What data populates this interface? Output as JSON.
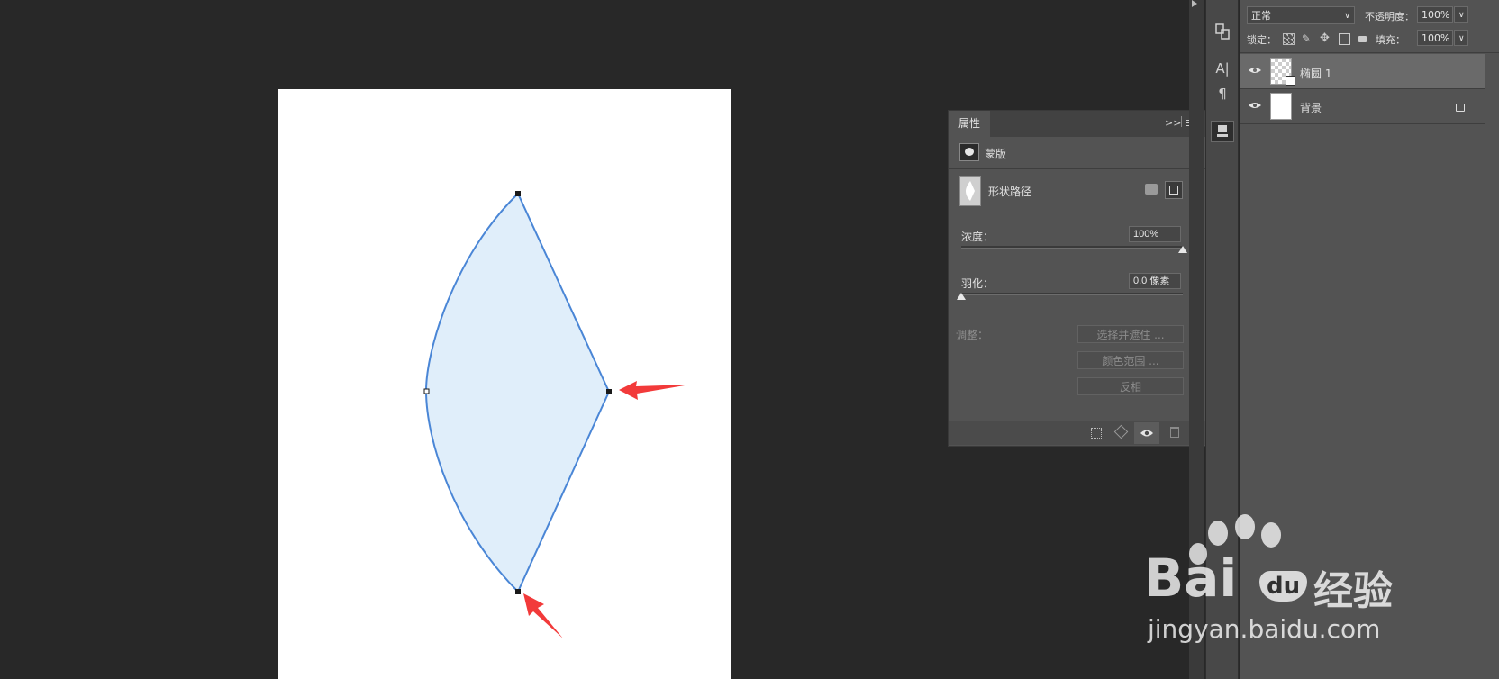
{
  "properties_panel": {
    "tab_label": "属性",
    "section_mask_label": "蒙版",
    "section_shape_path_label": "形状路径",
    "density_label": "浓度：",
    "density_value": "100%",
    "density_level": 1.0,
    "feather_label": "羽化：",
    "feather_value": "0.0 像素",
    "feather_level": 0.0,
    "adjust_label": "调整：",
    "btn_select_and_mask": "选择并遮住 ...",
    "btn_color_range": "颜色范围 ...",
    "btn_invert": "反相"
  },
  "layers_panel": {
    "blend_mode": "正常",
    "opacity_label": "不透明度：",
    "opacity_value": "100%",
    "lock_label": "锁定：",
    "fill_label": "填充：",
    "fill_value": "100%",
    "layers": [
      {
        "name": "椭圆 1",
        "selected": true
      },
      {
        "name": "背景",
        "selected": false,
        "locked": true
      }
    ]
  },
  "watermark": {
    "brand_left": "Bai",
    "brand_du": "du",
    "brand_cn": "经验",
    "url": "jingyan.baidu.com"
  },
  "colors": {
    "shape_fill": "#e0eefa",
    "path_stroke": "#4a86d6",
    "arrow": "#f23a3a",
    "workspace": "#282828",
    "panel": "#535353"
  }
}
